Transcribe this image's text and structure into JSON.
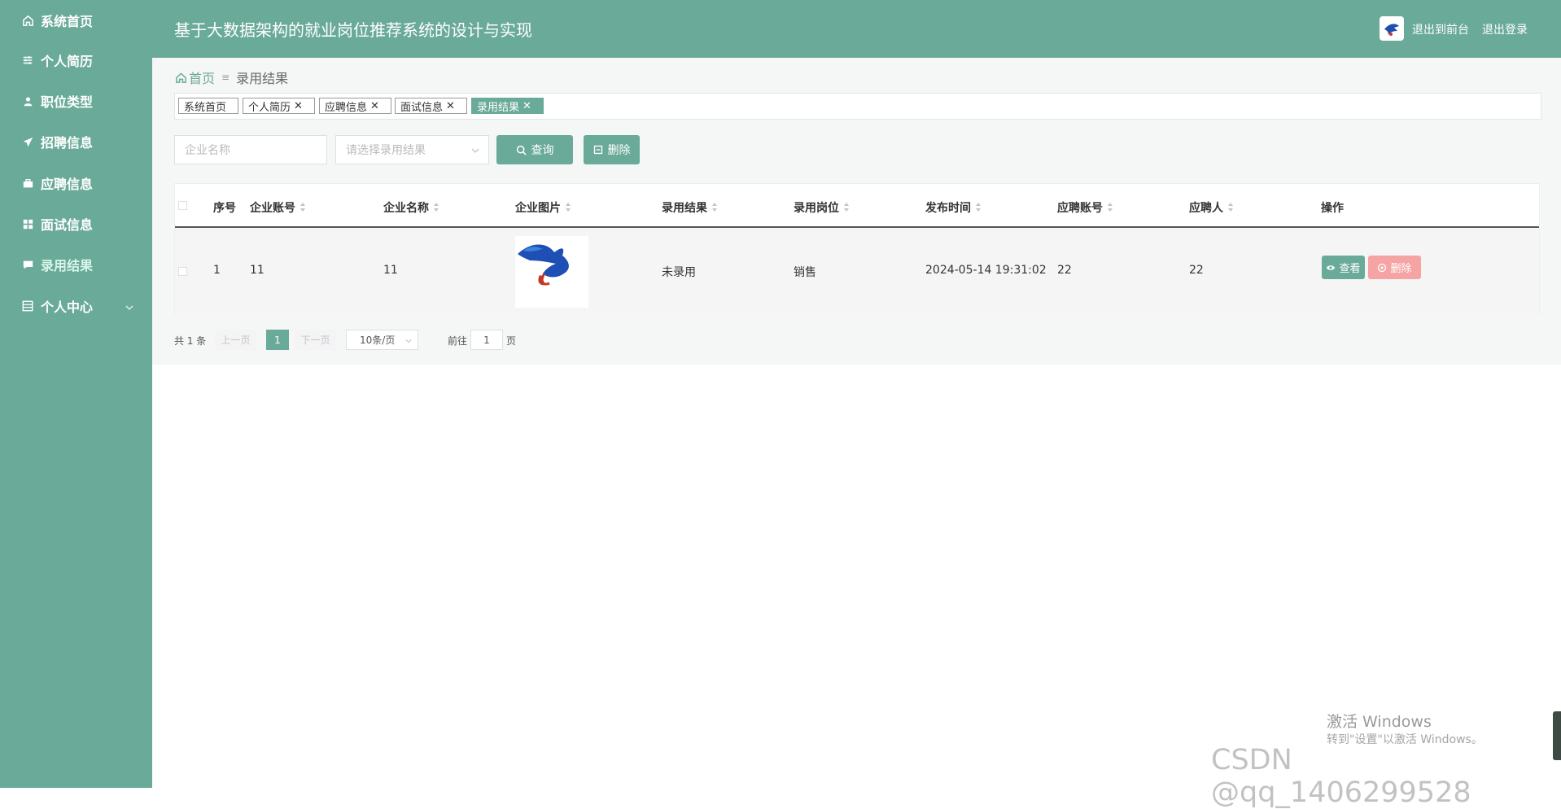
{
  "sidebar": {
    "items": [
      {
        "label": "系统首页",
        "icon": "home-icon"
      },
      {
        "label": "个人简历",
        "icon": "sliders-icon"
      },
      {
        "label": "职位类型",
        "icon": "user-icon"
      },
      {
        "label": "招聘信息",
        "icon": "send-icon"
      },
      {
        "label": "应聘信息",
        "icon": "briefcase-icon"
      },
      {
        "label": "面试信息",
        "icon": "grid-icon"
      },
      {
        "label": "录用结果",
        "icon": "message-icon"
      },
      {
        "label": "个人中心",
        "icon": "document-icon"
      }
    ],
    "active_index": 6
  },
  "header": {
    "title": "基于大数据架构的就业岗位推荐系统的设计与实现",
    "frontend_link": "退出到前台",
    "logout_link": "退出登录"
  },
  "breadcrumb": {
    "home": "首页",
    "current": "录用结果"
  },
  "tags": [
    {
      "label": "系统首页",
      "closable": false,
      "active": false
    },
    {
      "label": "个人简历",
      "closable": true,
      "active": false
    },
    {
      "label": "应聘信息",
      "closable": true,
      "active": false
    },
    {
      "label": "面试信息",
      "closable": true,
      "active": false
    },
    {
      "label": "录用结果",
      "closable": true,
      "active": true
    }
  ],
  "search": {
    "company_placeholder": "企业名称",
    "result_placeholder": "请选择录用结果",
    "query_label": "查询",
    "delete_label": "删除"
  },
  "table": {
    "headers": [
      "序号",
      "企业账号",
      "企业名称",
      "企业图片",
      "录用结果",
      "录用岗位",
      "发布时间",
      "应聘账号",
      "应聘人",
      "操作"
    ],
    "rows": [
      {
        "index": "1",
        "company_account": "11",
        "company_name": "11",
        "result": "未录用",
        "position": "销售",
        "publish_time": "2024-05-14 19:31:02",
        "applicant_account": "22",
        "applicant": "22",
        "view_label": "查看",
        "delete_label": "删除"
      }
    ]
  },
  "pagination": {
    "total": "共 1 条",
    "prev": "上一页",
    "page": "1",
    "next": "下一页",
    "page_size": "10条/页",
    "goto_label": "前往",
    "goto_value": "1",
    "page_unit": "页"
  },
  "watermark": {
    "activate_title": "激活 Windows",
    "activate_sub": "转到\"设置\"以激活 Windows。",
    "csdn": "CSDN @qq_1406299528"
  },
  "colors": {
    "primary": "#6aaa98",
    "danger": "#f5a3a3",
    "page_bg": "#f5f6f6"
  }
}
